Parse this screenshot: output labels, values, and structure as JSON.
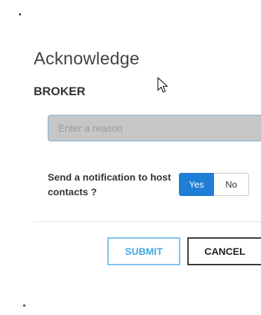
{
  "dialog": {
    "title": "Acknowledge",
    "subtitle": "BROKER",
    "reason_input": {
      "value": "",
      "placeholder": "Enter a reason"
    },
    "notification": {
      "label": "Send a notification to host contacts ?",
      "yes_label": "Yes",
      "no_label": "No",
      "selected": "Yes"
    },
    "buttons": {
      "submit_label": "SUBMIT",
      "cancel_label": "CANCEL"
    }
  },
  "colors": {
    "primary": "#1e7ed6",
    "submit_text": "#45a6de",
    "submit_border": "#7ec1ea",
    "input_bg": "#c6c6c6",
    "input_border": "#7fb3d8"
  },
  "icons": {
    "cursor": "mouse-pointer-arrow"
  }
}
